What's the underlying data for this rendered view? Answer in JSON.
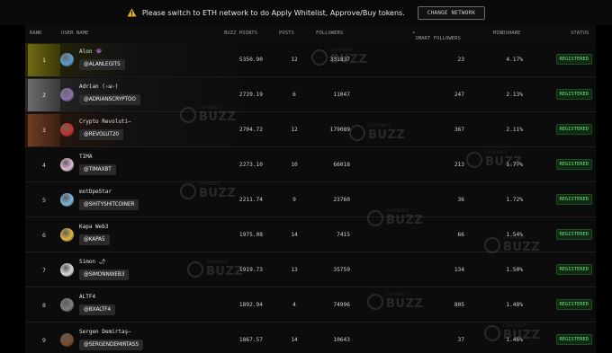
{
  "banner": {
    "message": "Please switch to ETH network to do Apply Whitelist, Approve/Buy tokens.",
    "button": "CHANGE NETWORK"
  },
  "columns": {
    "rank": "RANK",
    "user": "USER NAME",
    "points": "BUZZ POINTS",
    "posts": "POSTS",
    "followers": "FOLLOWERS",
    "smart": "SMART FOLLOWERS",
    "mindshare": "MINDSHARE",
    "status": "STATUS"
  },
  "watermark": {
    "top": "CHAINBIT",
    "bottom": "BUZZ"
  },
  "rows": [
    {
      "rank": "1",
      "name": "Alon 👾",
      "handle": "@ALANLEGITS",
      "points": "5350.90",
      "posts": "12",
      "followers": "331837",
      "smart": "23",
      "mindshare": "4.17%",
      "status": "REGISTERED",
      "avatar": "#5a9bd8"
    },
    {
      "rank": "2",
      "name": "Adrian (✧ω✧)",
      "handle": "@ADRIANSCRYPTOO",
      "points": "2729.19",
      "posts": "6",
      "followers": "11047",
      "smart": "247",
      "mindshare": "2.13%",
      "status": "REGISTERED",
      "avatar": "#8a6fb0"
    },
    {
      "rank": "3",
      "name": "Crypto Revoluti—",
      "handle": "@REVOLUT20",
      "points": "2704.72",
      "posts": "12",
      "followers": "179089",
      "smart": "367",
      "mindshare": "2.11%",
      "status": "REGISTERED",
      "avatar": "#c4302b"
    },
    {
      "rank": "4",
      "name": "TIMA",
      "handle": "@TIMAXBT",
      "points": "2273.10",
      "posts": "10",
      "followers": "66018",
      "smart": "213",
      "mindshare": "1.77%",
      "status": "REGISTERED",
      "avatar": "#e0b8d6"
    },
    {
      "rank": "5",
      "name": "motDpeStar",
      "handle": "@SHITYSHITCOINER",
      "points": "2211.74",
      "posts": "9",
      "followers": "23760",
      "smart": "36",
      "mindshare": "1.72%",
      "status": "REGISTERED",
      "avatar": "#7ab6d9"
    },
    {
      "rank": "6",
      "name": "Kapa Web3",
      "handle": "@KAPA5",
      "points": "1975.08",
      "posts": "14",
      "followers": "7415",
      "smart": "66",
      "mindshare": "1.54%",
      "status": "REGISTERED",
      "avatar": "#e3b43a"
    },
    {
      "rank": "7",
      "name": "Simon 🌶",
      "handle": "@SIMONNWEB3",
      "points": "1919.73",
      "posts": "13",
      "followers": "35759",
      "smart": "134",
      "mindshare": "1.50%",
      "status": "REGISTERED",
      "avatar": "#d8d8d8"
    },
    {
      "rank": "8",
      "name": "ALTF4",
      "handle": "@BXALTF4",
      "points": "1892.94",
      "posts": "4",
      "followers": "74996",
      "smart": "805",
      "mindshare": "1.48%",
      "status": "REGISTERED",
      "avatar": "#7d7d7d"
    },
    {
      "rank": "9",
      "name": "Sergen Demirtaş—",
      "handle": "@SERGENDEMIRTASS",
      "points": "1867.57",
      "posts": "14",
      "followers": "10643",
      "smart": "37",
      "mindshare": "1.46%",
      "status": "REGISTERED",
      "avatar": "#7a4a2a"
    }
  ]
}
